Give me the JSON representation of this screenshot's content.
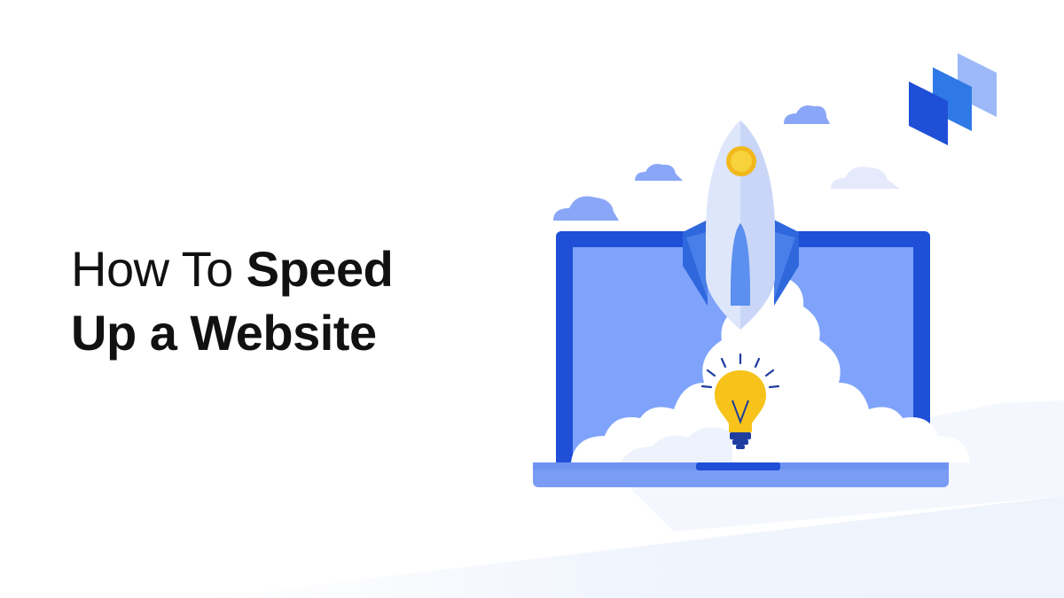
{
  "headline": {
    "line1_regular": "How To ",
    "line1_bold": "Speed",
    "line2_bold": "Up a Website"
  },
  "colors": {
    "laptop_frame": "#1f4fd6",
    "laptop_screen": "#7fa3fb",
    "laptop_base": "#7a9cf5",
    "cloud_blue": "#7f9ff7",
    "cloud_light": "#e6ecfb",
    "rocket_body": "#dde6fb",
    "rocket_fin": "#2f68dd",
    "porthole": "#f2c21b",
    "bulb": "#f5c518",
    "logo_dark": "#1f4fd6",
    "logo_mid": "#2f79e6",
    "logo_light": "#8fb0f7"
  },
  "icons": {
    "brand_logo": "stacked-panels-logo-icon",
    "illustration": "rocket-launch-from-laptop",
    "bulb": "lightbulb-icon"
  }
}
